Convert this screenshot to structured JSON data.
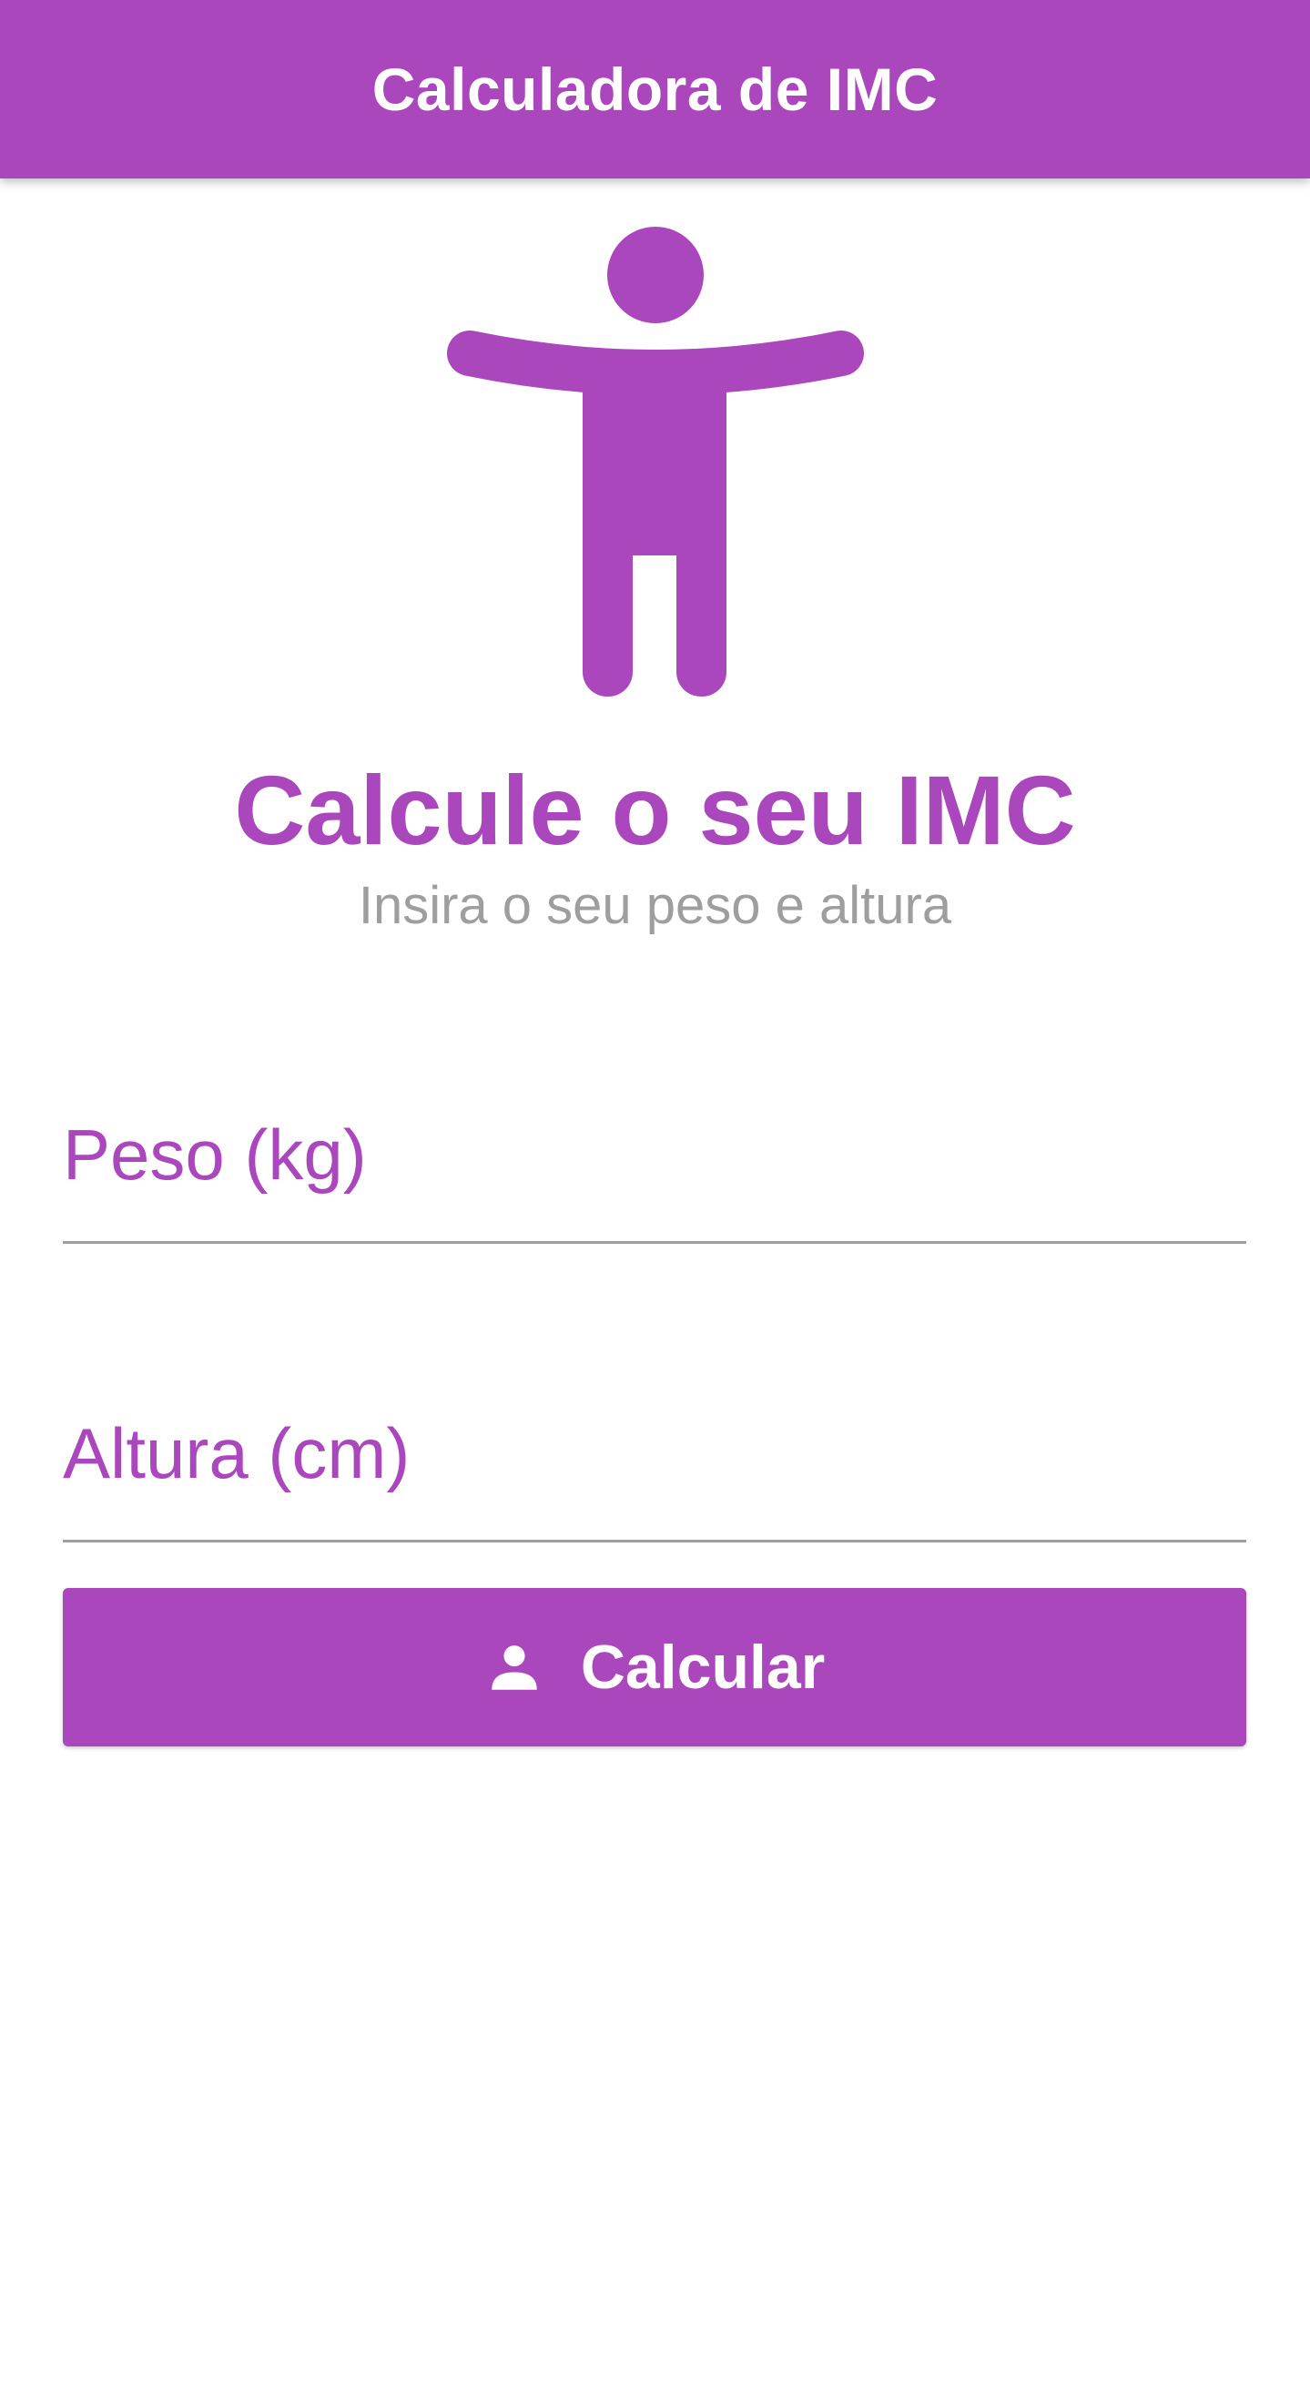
{
  "app_bar": {
    "title": "Calculadora de IMC"
  },
  "hero": {
    "icon": "accessibility-person-icon",
    "title": "Calcule o seu IMC",
    "subtitle": "Insira o seu peso e altura"
  },
  "form": {
    "weight_placeholder": "Peso (kg)",
    "weight_value": "",
    "height_placeholder": "Altura (cm)",
    "height_value": ""
  },
  "calculate_button": {
    "icon": "person-icon",
    "label": "Calcular"
  },
  "colors": {
    "primary": "#AB47BC",
    "subtitle_text": "#9E9E9E",
    "underline": "#9E9E9E",
    "background": "#FFFFFF"
  }
}
